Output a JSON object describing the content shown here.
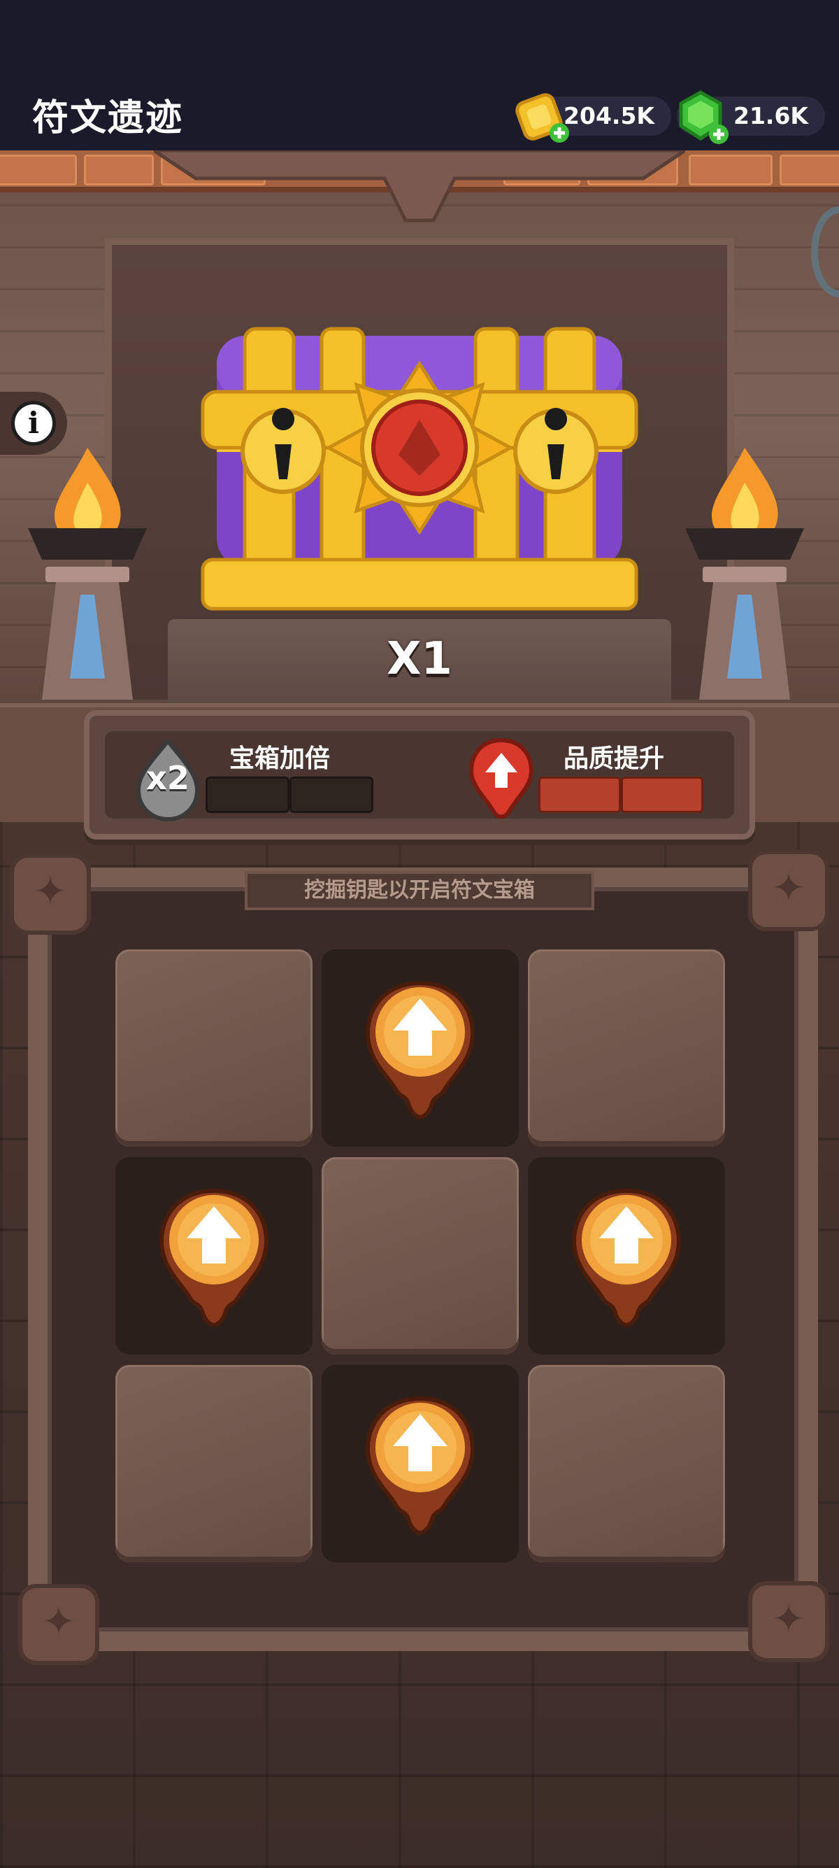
{
  "header": {
    "title": "符文遗迹",
    "gold_amount": "204.5K",
    "gem_amount": "21.6K"
  },
  "chest": {
    "multiplier_label": "X1"
  },
  "bonuses": {
    "chest_double": {
      "label": "宝箱加倍",
      "badge": "x2",
      "progress": 0,
      "segments": 2
    },
    "quality_up": {
      "label": "品质提升",
      "progress": 1.0,
      "segments": 2
    }
  },
  "board": {
    "hint": "挖掘钥匙以开启符文宝箱",
    "cells": [
      {
        "state": "solid",
        "item": ""
      },
      {
        "state": "dug",
        "item": "quality-up-orb"
      },
      {
        "state": "solid",
        "item": ""
      },
      {
        "state": "dug",
        "item": "quality-up-orb"
      },
      {
        "state": "solid",
        "item": ""
      },
      {
        "state": "dug",
        "item": "quality-up-orb"
      },
      {
        "state": "solid",
        "item": ""
      },
      {
        "state": "dug",
        "item": "quality-up-orb"
      },
      {
        "state": "solid",
        "item": ""
      }
    ]
  },
  "colors": {
    "topbar": "#1b1a2b",
    "quality_bar": "#b5402b",
    "orb": "#f2a23a"
  }
}
